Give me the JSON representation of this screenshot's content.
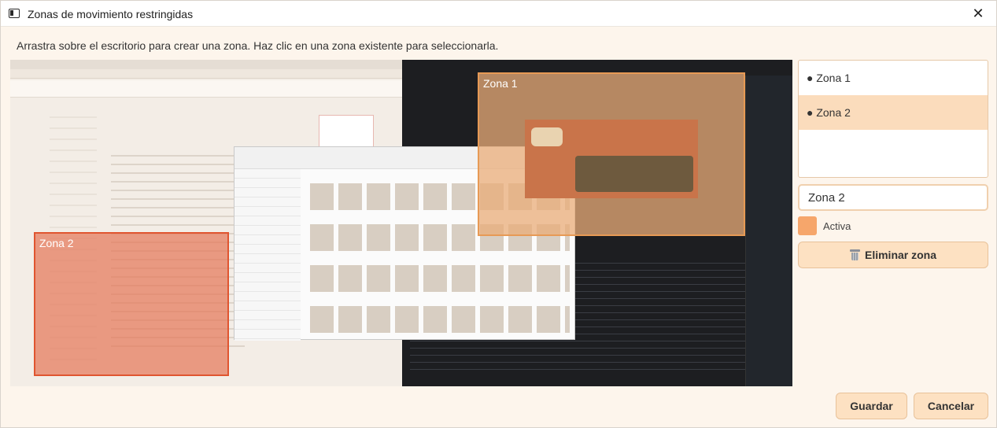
{
  "window": {
    "title": "Zonas de movimiento restringidas",
    "close_glyph": "✕"
  },
  "instructions": "Arrastra sobre el escritorio para crear una zona. Haz clic en una zona existente para seleccionarla.",
  "canvas": {
    "zones": [
      {
        "label": "Zona 1",
        "color": "#eaac78"
      },
      {
        "label": "Zona 2",
        "color": "#e4785a"
      }
    ]
  },
  "sidebar": {
    "zone_list": [
      {
        "label": "● Zona 1",
        "selected": false
      },
      {
        "label": "● Zona 2",
        "selected": true
      }
    ],
    "name_value": "Zona 2",
    "active_label": "Activa",
    "active_checked": true,
    "delete_label": "Eliminar zona",
    "delete_icon": "trash-icon"
  },
  "footer": {
    "save_label": "Guardar",
    "cancel_label": "Cancelar"
  },
  "colors": {
    "accent": "#fde1c2",
    "selected_item": "#fbdcbc",
    "checkbox": "#f6a66b",
    "zone_2_border": "#e05530"
  }
}
